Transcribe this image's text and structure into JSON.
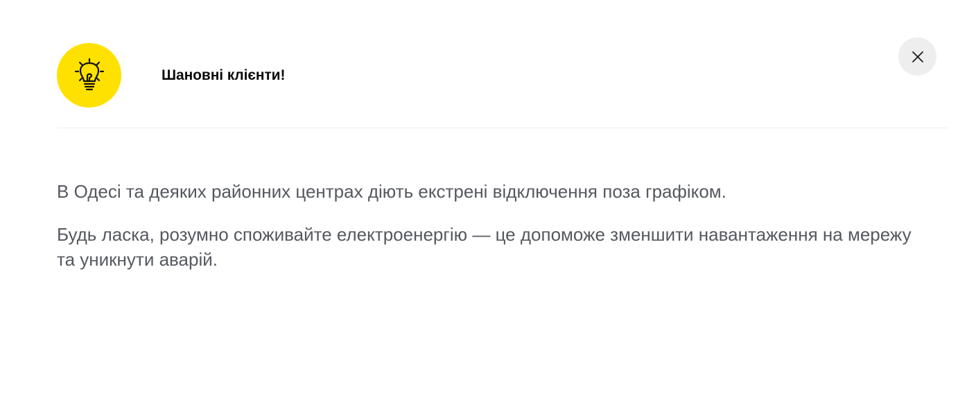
{
  "notice": {
    "icon": "lightbulb-icon",
    "accent_color": "#FFE100",
    "title": "Шановні клієнти!",
    "close_icon": "close-icon",
    "paragraphs": [
      "В Одесі та деяких районних центрах діють екстрені відключення поза графіком.",
      "Будь ласка, розумно споживайте електроенергію — це допоможе зменшити навантаження на мережу та уникнути аварій."
    ]
  }
}
